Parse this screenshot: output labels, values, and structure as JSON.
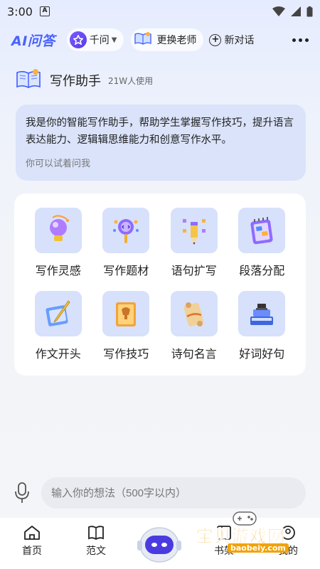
{
  "status": {
    "time": "3:00",
    "notif_letter": "A"
  },
  "header": {
    "logo": "AI问答",
    "model": {
      "label": "千问",
      "icon": "model-star-icon"
    },
    "change_teacher": {
      "label": "更换老师",
      "icon": "book-icon"
    },
    "new_chat": {
      "label": "新对话",
      "icon": "plus-circle-icon"
    },
    "more_icon": "more-dots-icon"
  },
  "assistant": {
    "name": "写作助手",
    "usage": "21W人使用",
    "intro": "我是你的智能写作助手，帮助学生掌握写作技巧，提升语言表达能力、逻辑辑思维能力和创意写作水平。",
    "hint": "你可以试着问我"
  },
  "tools": [
    {
      "label": "写作灵感",
      "icon": "lightbulb-icon"
    },
    {
      "label": "写作题材",
      "icon": "magnifier-icon"
    },
    {
      "label": "语句扩写",
      "icon": "pencil-icon"
    },
    {
      "label": "段落分配",
      "icon": "notepad-icon"
    },
    {
      "label": "作文开头",
      "icon": "quill-icon"
    },
    {
      "label": "写作技巧",
      "icon": "book-icon"
    },
    {
      "label": "诗句名言",
      "icon": "scroll-icon"
    },
    {
      "label": "好词好句",
      "icon": "books-icon"
    }
  ],
  "input": {
    "placeholder": "输入你的想法（500字以内）"
  },
  "nav": [
    {
      "label": "首页",
      "icon": "home-icon"
    },
    {
      "label": "范文",
      "icon": "open-book-icon"
    },
    {
      "label": "",
      "icon": "robot-icon"
    },
    {
      "label": "书架",
      "icon": "shelf-icon"
    },
    {
      "label": "我的",
      "icon": "user-icon"
    }
  ],
  "watermark": {
    "text": "宝贝游戏网",
    "url": "baobeiy.com"
  },
  "colors": {
    "brand": "#4a63ff",
    "tile_bg": "#d7e1fb",
    "bubble_bg": "#d7e1fa"
  }
}
